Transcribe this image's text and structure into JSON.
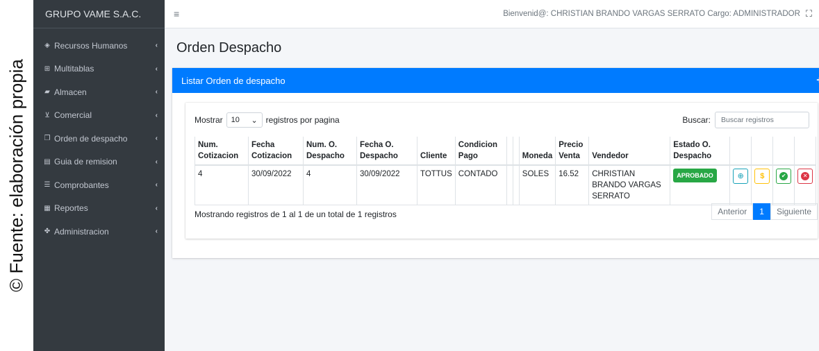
{
  "caption": "© Fuente: elaboración propia",
  "sidebar": {
    "brand": "GRUPO VAME S.A.C.",
    "items": [
      {
        "icon": "tag-icon",
        "glyph": "◈",
        "label": "Recursos Humanos"
      },
      {
        "icon": "table-icon",
        "glyph": "⊞",
        "label": "Multitablas"
      },
      {
        "icon": "truck-icon",
        "glyph": "▰",
        "label": "Almacen"
      },
      {
        "icon": "cart-icon",
        "glyph": "⊻",
        "label": "Comercial"
      },
      {
        "icon": "copy-icon",
        "glyph": "❐",
        "label": "Orden de despacho"
      },
      {
        "icon": "file-icon",
        "glyph": "▤",
        "label": "Guia de remision"
      },
      {
        "icon": "list-icon",
        "glyph": "☰",
        "label": "Comprobantes"
      },
      {
        "icon": "report-icon",
        "glyph": "▦",
        "label": "Reportes"
      },
      {
        "icon": "users-icon",
        "glyph": "✤",
        "label": "Administracion"
      }
    ]
  },
  "topbar": {
    "welcome": "Bienvenid@: CHRISTIAN BRANDO VARGAS SERRATO   Cargo: ADMINISTRADOR"
  },
  "page": {
    "title": "Orden Despacho",
    "card_title": "Listar Orden de despacho",
    "show_label": "Mostrar",
    "page_size": "10",
    "per_page_label": "registros por pagina",
    "search_label": "Buscar:",
    "search_placeholder": "Buscar registros",
    "columns": [
      "Num. Cotizacion",
      "Fecha Cotizacion",
      "Num. O. Despacho",
      "Fecha O. Despacho",
      "Cliente",
      "Condicion Pago",
      "",
      "",
      "Moneda",
      "Precio Venta",
      "Vendedor",
      "Estado O. Despacho"
    ],
    "rows": [
      {
        "num_cot": "4",
        "fecha_cot": "30/09/2022",
        "num_desp": "4",
        "fecha_desp": "30/09/2022",
        "cliente": "TOTTUS",
        "condicion": "CONTADO",
        "moneda": "SOLES",
        "precio": "16.52",
        "vendedor": "CHRISTIAN BRANDO VARGAS SERRATO",
        "estado": "APROBADO"
      }
    ],
    "info": "Mostrando registros de 1 al 1 de un total de 1 registros",
    "pager": {
      "prev": "Anterior",
      "current": "1",
      "next": "Siguiente"
    }
  },
  "colors": {
    "primary": "#007bff",
    "sidebar": "#343a40",
    "success": "#28a745",
    "danger": "#dc3545",
    "warning": "#ffc107",
    "info": "#17a2b8"
  }
}
